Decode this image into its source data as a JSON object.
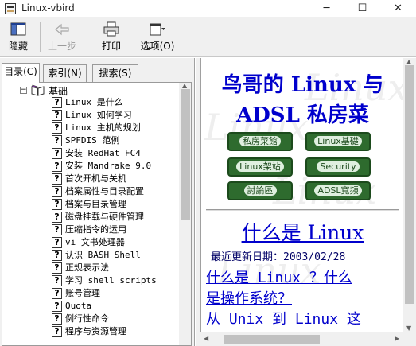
{
  "window": {
    "title": "Linux-vbird",
    "minimize": "─",
    "maximize": "☐",
    "close": "✕"
  },
  "toolbar": {
    "hide_label": "隐藏",
    "back_label": "上一步",
    "print_label": "打印",
    "options_label": "选项(O)"
  },
  "tabs": {
    "contents": "目录(C)",
    "index": "索引(N)",
    "search": "搜索(S)"
  },
  "tree": {
    "root_label": "基础",
    "collapse_glyph": "−",
    "items": [
      "Linux 是什么",
      "Linux 如何学习",
      "Linux 主机的规划",
      "SPFDIS 范例",
      "安装 RedHat FC4",
      "安装 Mandrake 9.0",
      "首次开机与关机",
      "档案属性与目录配置",
      "档案与目录管理",
      "磁盘挂载与硬件管理",
      "压缩指令的运用",
      "vi 文书处理器",
      "认识 BASH Shell",
      "正规表示法",
      "学习 shell scripts",
      "账号管理",
      "Quota",
      "例行性命令",
      "程序与资源管理"
    ],
    "item_icon": "?"
  },
  "content": {
    "title": "鸟哥的 Linux 与 ADSL 私房菜",
    "nav_buttons": [
      "私房菜館",
      "Linux基礎",
      "Linux架站",
      "Security",
      "討論區",
      "ADSL寬頻"
    ],
    "heading": "什么是 Linux",
    "updated": "最近更新日期：2003/02/28",
    "links": [
      "什么是 Linux ？什么",
      "是操作系统？",
      "从 Unix 到 Linux 这"
    ],
    "watermark": "Linux"
  },
  "colors": {
    "link": "#0000cc",
    "nav_button": "#2e6b2e"
  }
}
